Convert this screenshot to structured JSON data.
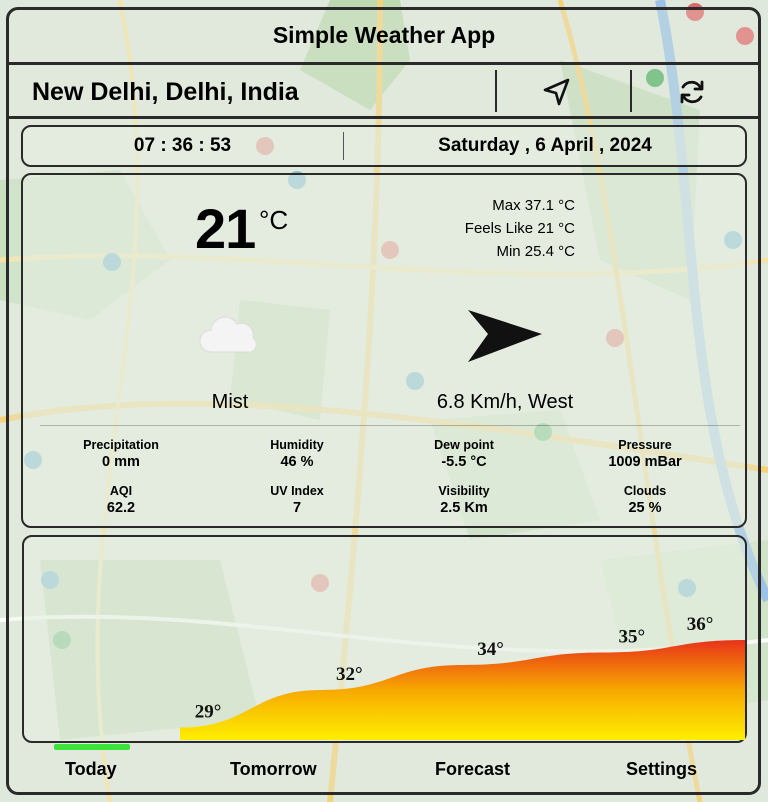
{
  "app": {
    "title": "Simple Weather App"
  },
  "location": {
    "name": "New Delhi, Delhi, India"
  },
  "clock": {
    "time": "07 : 36 : 53",
    "date": "Saturday , 6 April , 2024"
  },
  "current": {
    "temperature": "21",
    "unit": "°C",
    "max": "Max 37.1 °C",
    "feels_like": "Feels Like 21 °C",
    "min": "Min 25.4 °C",
    "condition": "Mist",
    "wind": "6.8 Km/h, West"
  },
  "metrics": {
    "precipitation": {
      "label": "Precipitation",
      "value": "0 mm"
    },
    "humidity": {
      "label": "Humidity",
      "value": "46 %"
    },
    "dew_point": {
      "label": "Dew point",
      "value": "-5.5 °C"
    },
    "pressure": {
      "label": "Pressure",
      "value": "1009 mBar"
    },
    "aqi": {
      "label": "AQI",
      "value": "62.2"
    },
    "uv_index": {
      "label": "UV Index",
      "value": "7"
    },
    "visibility": {
      "label": "Visibility",
      "value": "2.5 Km"
    },
    "clouds": {
      "label": "Clouds",
      "value": "25 %"
    }
  },
  "chart_data": {
    "type": "area",
    "labels": [
      "29°",
      "32°",
      "34°",
      "35°",
      "36°"
    ],
    "values": [
      29,
      32,
      34,
      35,
      36
    ],
    "gradient": [
      "#ffef00",
      "#f7a900",
      "#e8321a"
    ]
  },
  "tabs": [
    "Today",
    "Tomorrow",
    "Forecast",
    "Settings"
  ],
  "icons": {
    "navigate": "navigation-arrow-icon",
    "refresh": "refresh-icon",
    "condition": "cloud-icon",
    "wind_direction": "wind-direction-arrow-icon"
  },
  "colors": {
    "frame": "#2a2a2a",
    "active_tab": "#3de33d"
  }
}
